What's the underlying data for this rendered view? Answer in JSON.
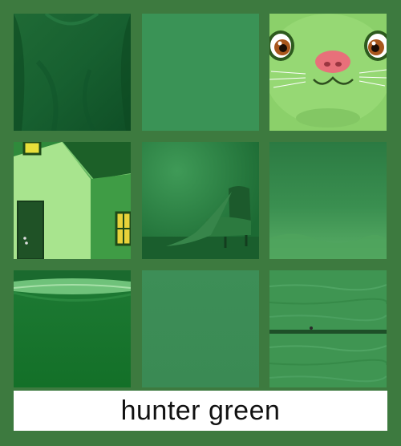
{
  "caption": {
    "text": "hunter green"
  },
  "tiles": [
    {
      "icon": "green-shirt-fabric-image"
    },
    {
      "icon": "solid-green-swatch"
    },
    {
      "icon": "green-cartoon-cat-face-image"
    },
    {
      "icon": "green-painted-house-image"
    },
    {
      "icon": "green-room-armchair-image"
    },
    {
      "icon": "green-gradient-haze-image"
    },
    {
      "icon": "green-bowl-rim-image"
    },
    {
      "icon": "flat-green-swatch"
    },
    {
      "icon": "green-wood-plank-image"
    }
  ],
  "colors": {
    "background": "#3d7a3f",
    "hunter_green": "#3a8a4f",
    "caption_bg": "#ffffff",
    "caption_text": "#111111"
  }
}
